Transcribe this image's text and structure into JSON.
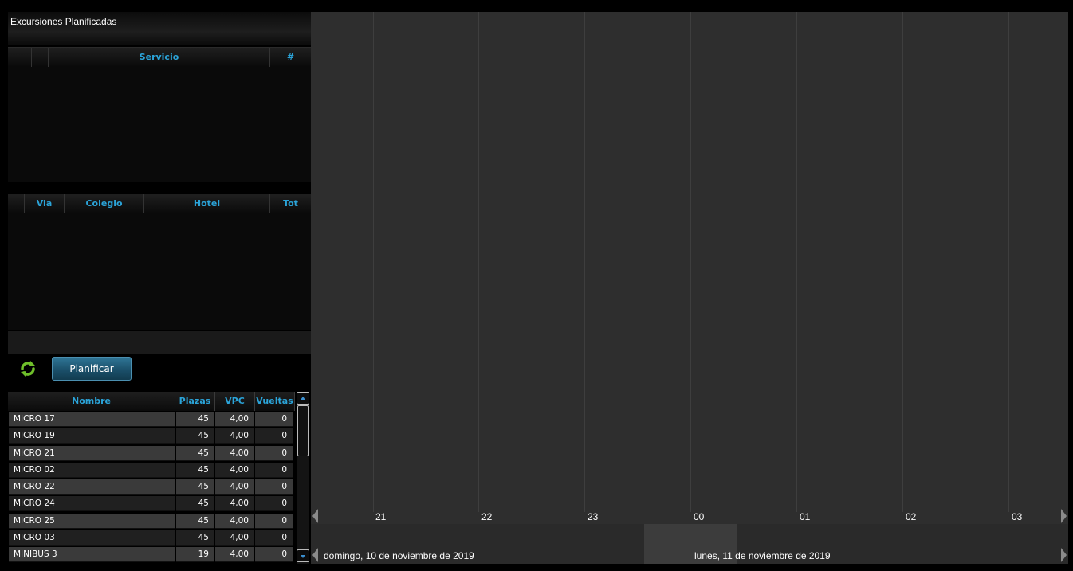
{
  "panel": {
    "title": "Excursiones Planificadas"
  },
  "services_grid": {
    "columns": [
      "",
      "",
      "Servicio",
      "#"
    ]
  },
  "detail_grid": {
    "columns": [
      "",
      "Via",
      "Colegio",
      "Hotel",
      "Tot"
    ]
  },
  "actions": {
    "refresh_icon": "refresh-icon",
    "plan_label": "Planificar"
  },
  "vehicles": {
    "columns": [
      "Nombre",
      "Plazas",
      "VPC",
      "Vueltas"
    ],
    "rows": [
      {
        "nombre": "MICRO 17",
        "plazas": "45",
        "vpc": "4,00",
        "vueltas": "0"
      },
      {
        "nombre": "MICRO 19",
        "plazas": "45",
        "vpc": "4,00",
        "vueltas": "0"
      },
      {
        "nombre": "MICRO 21",
        "plazas": "45",
        "vpc": "4,00",
        "vueltas": "0"
      },
      {
        "nombre": "MICRO 02",
        "plazas": "45",
        "vpc": "4,00",
        "vueltas": "0"
      },
      {
        "nombre": "MICRO 22",
        "plazas": "45",
        "vpc": "4,00",
        "vueltas": "0"
      },
      {
        "nombre": "MICRO 24",
        "plazas": "45",
        "vpc": "4,00",
        "vueltas": "0"
      },
      {
        "nombre": "MICRO 25",
        "plazas": "45",
        "vpc": "4,00",
        "vueltas": "0"
      },
      {
        "nombre": "MICRO 03",
        "plazas": "45",
        "vpc": "4,00",
        "vueltas": "0"
      },
      {
        "nombre": "MINIBUS 3",
        "plazas": "19",
        "vpc": "4,00",
        "vueltas": "0"
      }
    ]
  },
  "timeline": {
    "hours": [
      "21",
      "22",
      "23",
      "00",
      "01",
      "02",
      "03"
    ],
    "dates": [
      "domingo, 10 de noviembre de 2019",
      "lunes, 11 de noviembre de 2019"
    ],
    "colors": {
      "background": "#2e2e2e",
      "header_accent": "#2ba4d9"
    }
  }
}
